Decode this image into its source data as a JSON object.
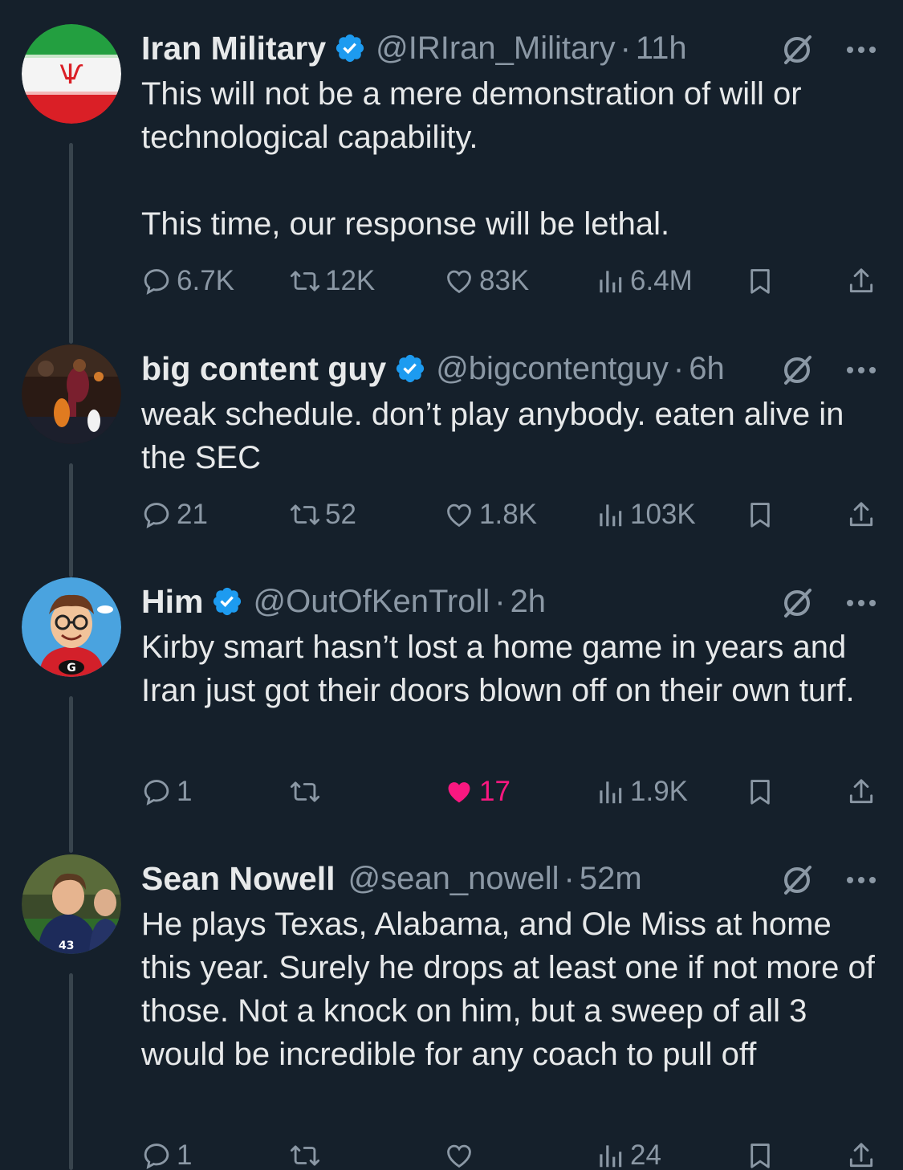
{
  "tweets": [
    {
      "name": "Iran Military",
      "verified": true,
      "handle": "@IRIran_Military",
      "time": "11h",
      "text": "This will not be a mere demonstration of will or technological capability.\n\nThis time, our response will be lethal.",
      "replies": "6.7K",
      "reposts": "12K",
      "likes": "83K",
      "views": "6.4M",
      "liked": false
    },
    {
      "name": "big content guy",
      "verified": true,
      "handle": "@bigcontentguy",
      "time": "6h",
      "text": "weak schedule. don’t play anybody. eaten alive in the SEC",
      "replies": "21",
      "reposts": "52",
      "likes": "1.8K",
      "views": "103K",
      "liked": false
    },
    {
      "name": "Him",
      "verified": true,
      "handle": "@OutOfKenTroll",
      "time": "2h",
      "text": "Kirby smart hasn’t lost a home game in years and Iran just got their doors blown off on their own turf.",
      "replies": "1",
      "reposts": "",
      "likes": "17",
      "views": "1.9K",
      "liked": true
    },
    {
      "name": "Sean Nowell",
      "verified": false,
      "handle": "@sean_nowell",
      "time": "52m",
      "text": "He plays Texas, Alabama, and Ole Miss at home this year. Surely he drops at least one if not more of those. Not a knock on him, but a sweep of all 3 would be incredible for any coach to pull off",
      "replies": "1",
      "reposts": "",
      "likes": "",
      "views": "24",
      "liked": false
    }
  ],
  "colors": {
    "background": "#15202b",
    "text": "#e7e9ea",
    "muted": "#8b98a5",
    "verified": "#1d9bf0",
    "like": "#f91880",
    "thread_line": "#38444d"
  },
  "icons": [
    "verified-badge-icon",
    "grok-icon",
    "more-icon",
    "reply-icon",
    "repost-icon",
    "like-icon",
    "views-icon",
    "bookmark-icon",
    "share-icon"
  ]
}
